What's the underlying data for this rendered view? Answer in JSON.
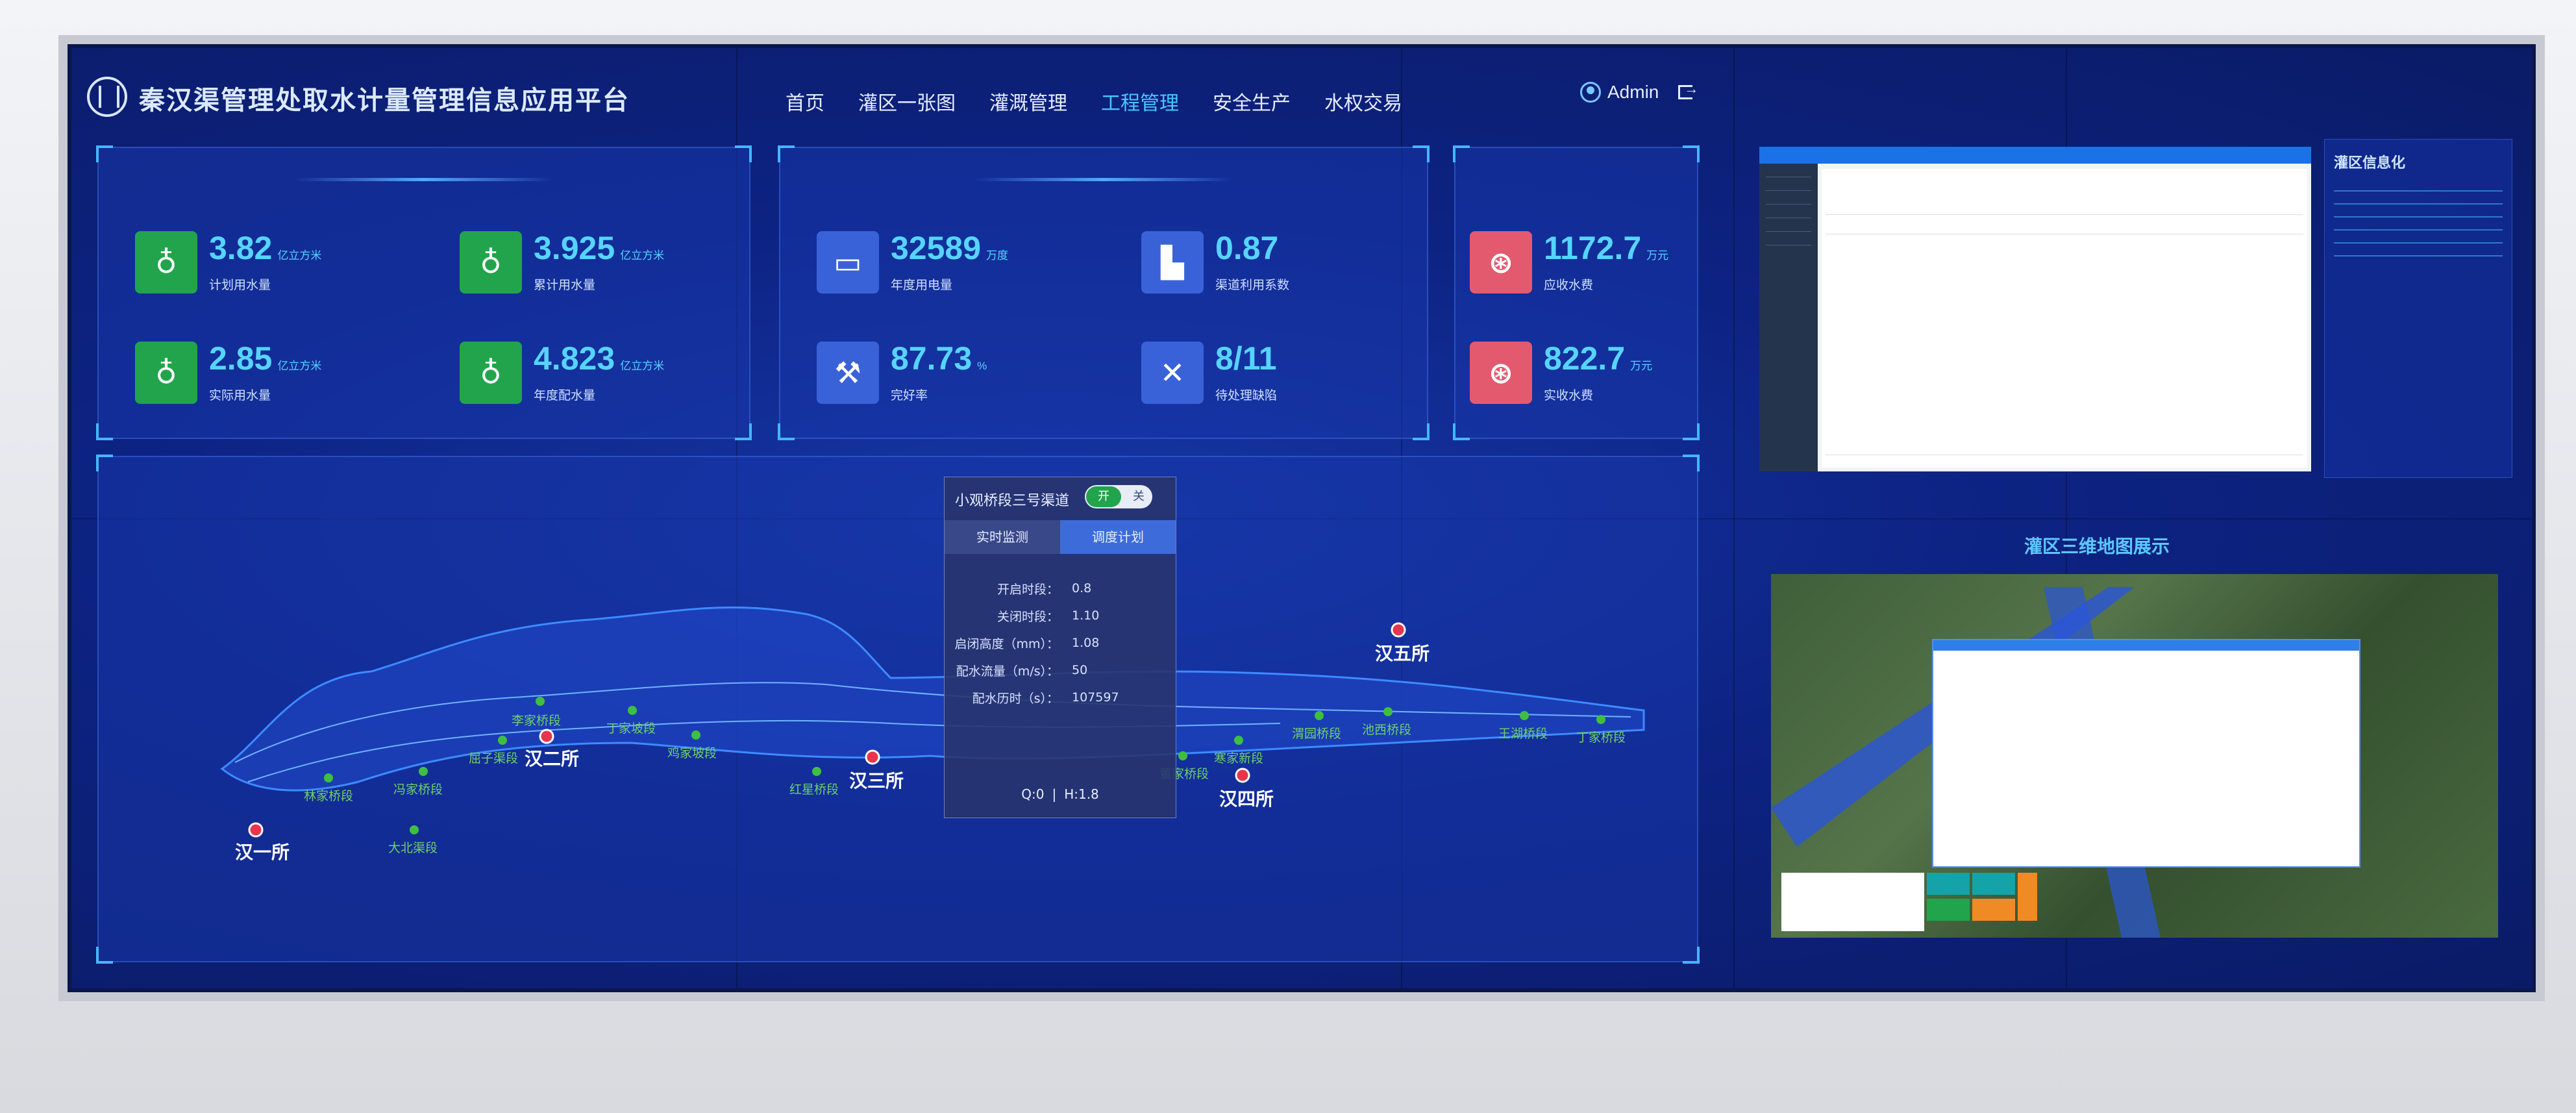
{
  "header": {
    "title": "秦汉渠管理处取水计量管理信息应用平台",
    "nav": [
      "首页",
      "灌区一张图",
      "灌溉管理",
      "工程管理",
      "安全生产",
      "水权交易"
    ],
    "active_nav": "工程管理",
    "user": "Admin"
  },
  "stats_group1": [
    {
      "value": "3.82",
      "unit": "亿立方米",
      "label": "计划用水量",
      "icon": "water-drop-icon",
      "color": "#22a44c"
    },
    {
      "value": "3.925",
      "unit": "亿立方米",
      "label": "累计用水量",
      "icon": "water-drop-icon",
      "color": "#22a44c"
    },
    {
      "value": "2.85",
      "unit": "亿立方米",
      "label": "实际用水量",
      "icon": "water-drop-icon",
      "color": "#22a44c"
    },
    {
      "value": "4.823",
      "unit": "亿立方米",
      "label": "年度配水量",
      "icon": "water-drop-icon",
      "color": "#22a44c"
    }
  ],
  "stats_group2": [
    {
      "value": "32589",
      "unit": "万度",
      "label": "年度用电量",
      "icon": "battery-icon",
      "color": "#3a62d8"
    },
    {
      "value": "0.87",
      "unit": "",
      "label": "渠道利用系数",
      "icon": "factory-icon",
      "color": "#3a62d8"
    },
    {
      "value": "87.73",
      "unit": "%",
      "label": "完好率",
      "icon": "wrench-icon",
      "color": "#3a62d8"
    },
    {
      "value": "8/11",
      "unit": "",
      "label": "待处理缺陷",
      "icon": "close-icon",
      "color": "#3a62d8"
    }
  ],
  "stats_group3": [
    {
      "value": "1172.7",
      "unit": "万元",
      "label": "应收水费",
      "icon": "money-icon",
      "color": "#e35a6e"
    },
    {
      "value": "822.7",
      "unit": "万元",
      "label": "实收水费",
      "icon": "money-icon",
      "color": "#e35a6e"
    }
  ],
  "map": {
    "stations": [
      "汉一所",
      "汉二所",
      "汉三所",
      "汉四所",
      "汉五所"
    ],
    "sections": [
      "李家桥段",
      "丁家坡段",
      "屈子渠段",
      "鸡家坡段",
      "林家桥段",
      "冯家桥段",
      "大北渠段",
      "红星桥段",
      "董家桥段",
      "寒家新段",
      "渭园桥段",
      "池西桥段",
      "王湖桥段",
      "丁家桥段"
    ]
  },
  "popup": {
    "title": "小观桥段三号渠道",
    "toggle_on": "开",
    "toggle_off": "关",
    "tabs": [
      "实时监测",
      "调度计划"
    ],
    "rows": [
      {
        "label": "开启时段：",
        "value": "0.8"
      },
      {
        "label": "关闭时段：",
        "value": "1.10"
      },
      {
        "label": "启闭高度（mm）：",
        "value": "1.08"
      },
      {
        "label": "配水流量（m/s）：",
        "value": "50"
      },
      {
        "label": "配水历时（s）：",
        "value": "107597"
      }
    ],
    "footer_q": "Q:0",
    "footer_h": "H:1.8"
  },
  "right": {
    "info_title": "灌区信息化",
    "map3d_title": "灌区三维地图展示"
  }
}
